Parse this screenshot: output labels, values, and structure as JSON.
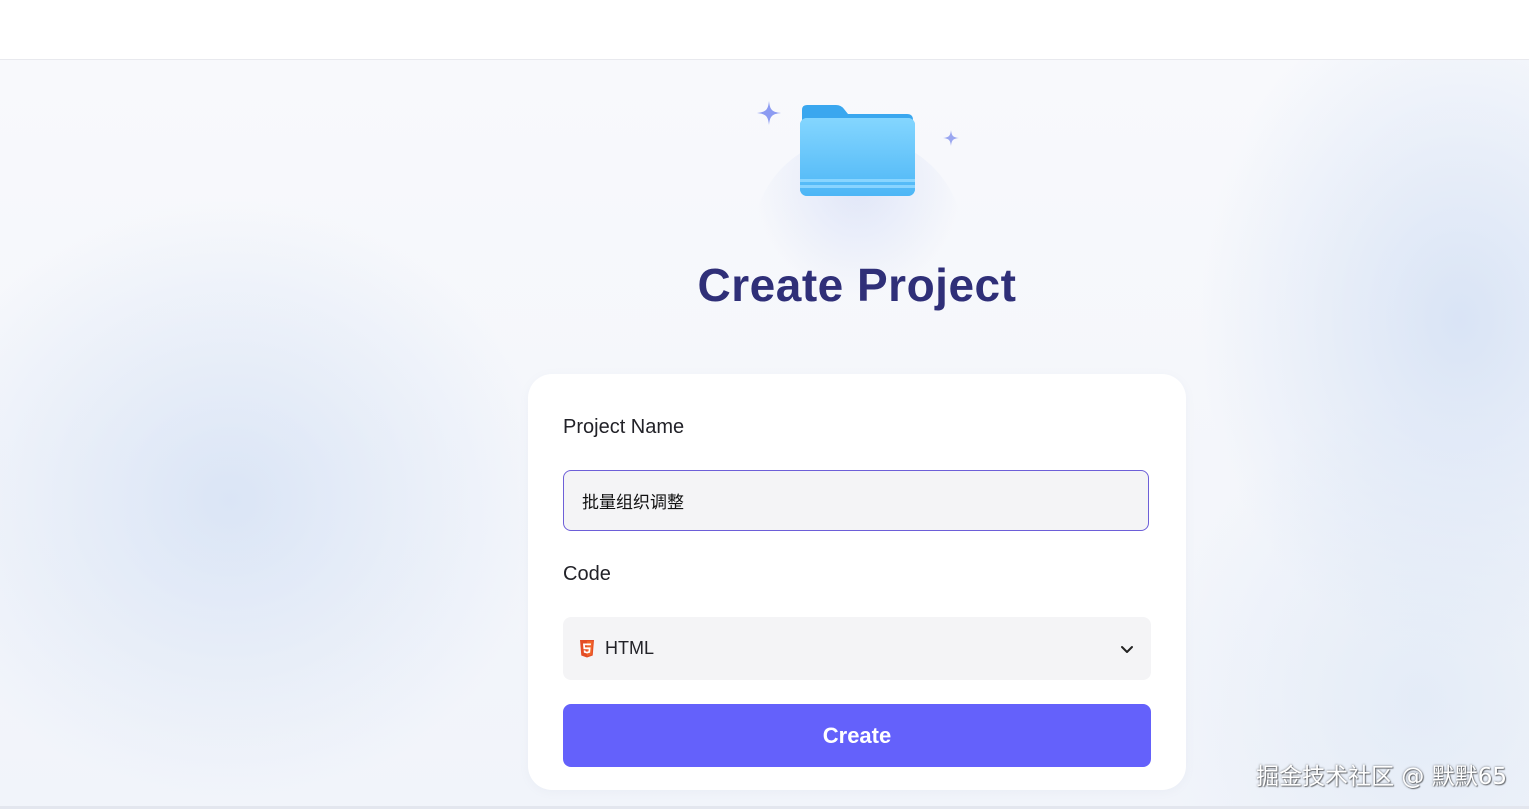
{
  "page": {
    "title": "Create Project"
  },
  "form": {
    "project_name_label": "Project Name",
    "project_name_value": "批量组织调整",
    "code_label": "Code",
    "code_selected": "HTML",
    "code_icon": "html5-icon",
    "submit_label": "Create"
  },
  "watermark": "掘金技术社区 @ 默默65",
  "colors": {
    "accent": "#6461fb",
    "title": "#2f2f78",
    "input_border": "#6d5fd8",
    "folder": "#5ec0fb",
    "html5": "#e44d26"
  }
}
